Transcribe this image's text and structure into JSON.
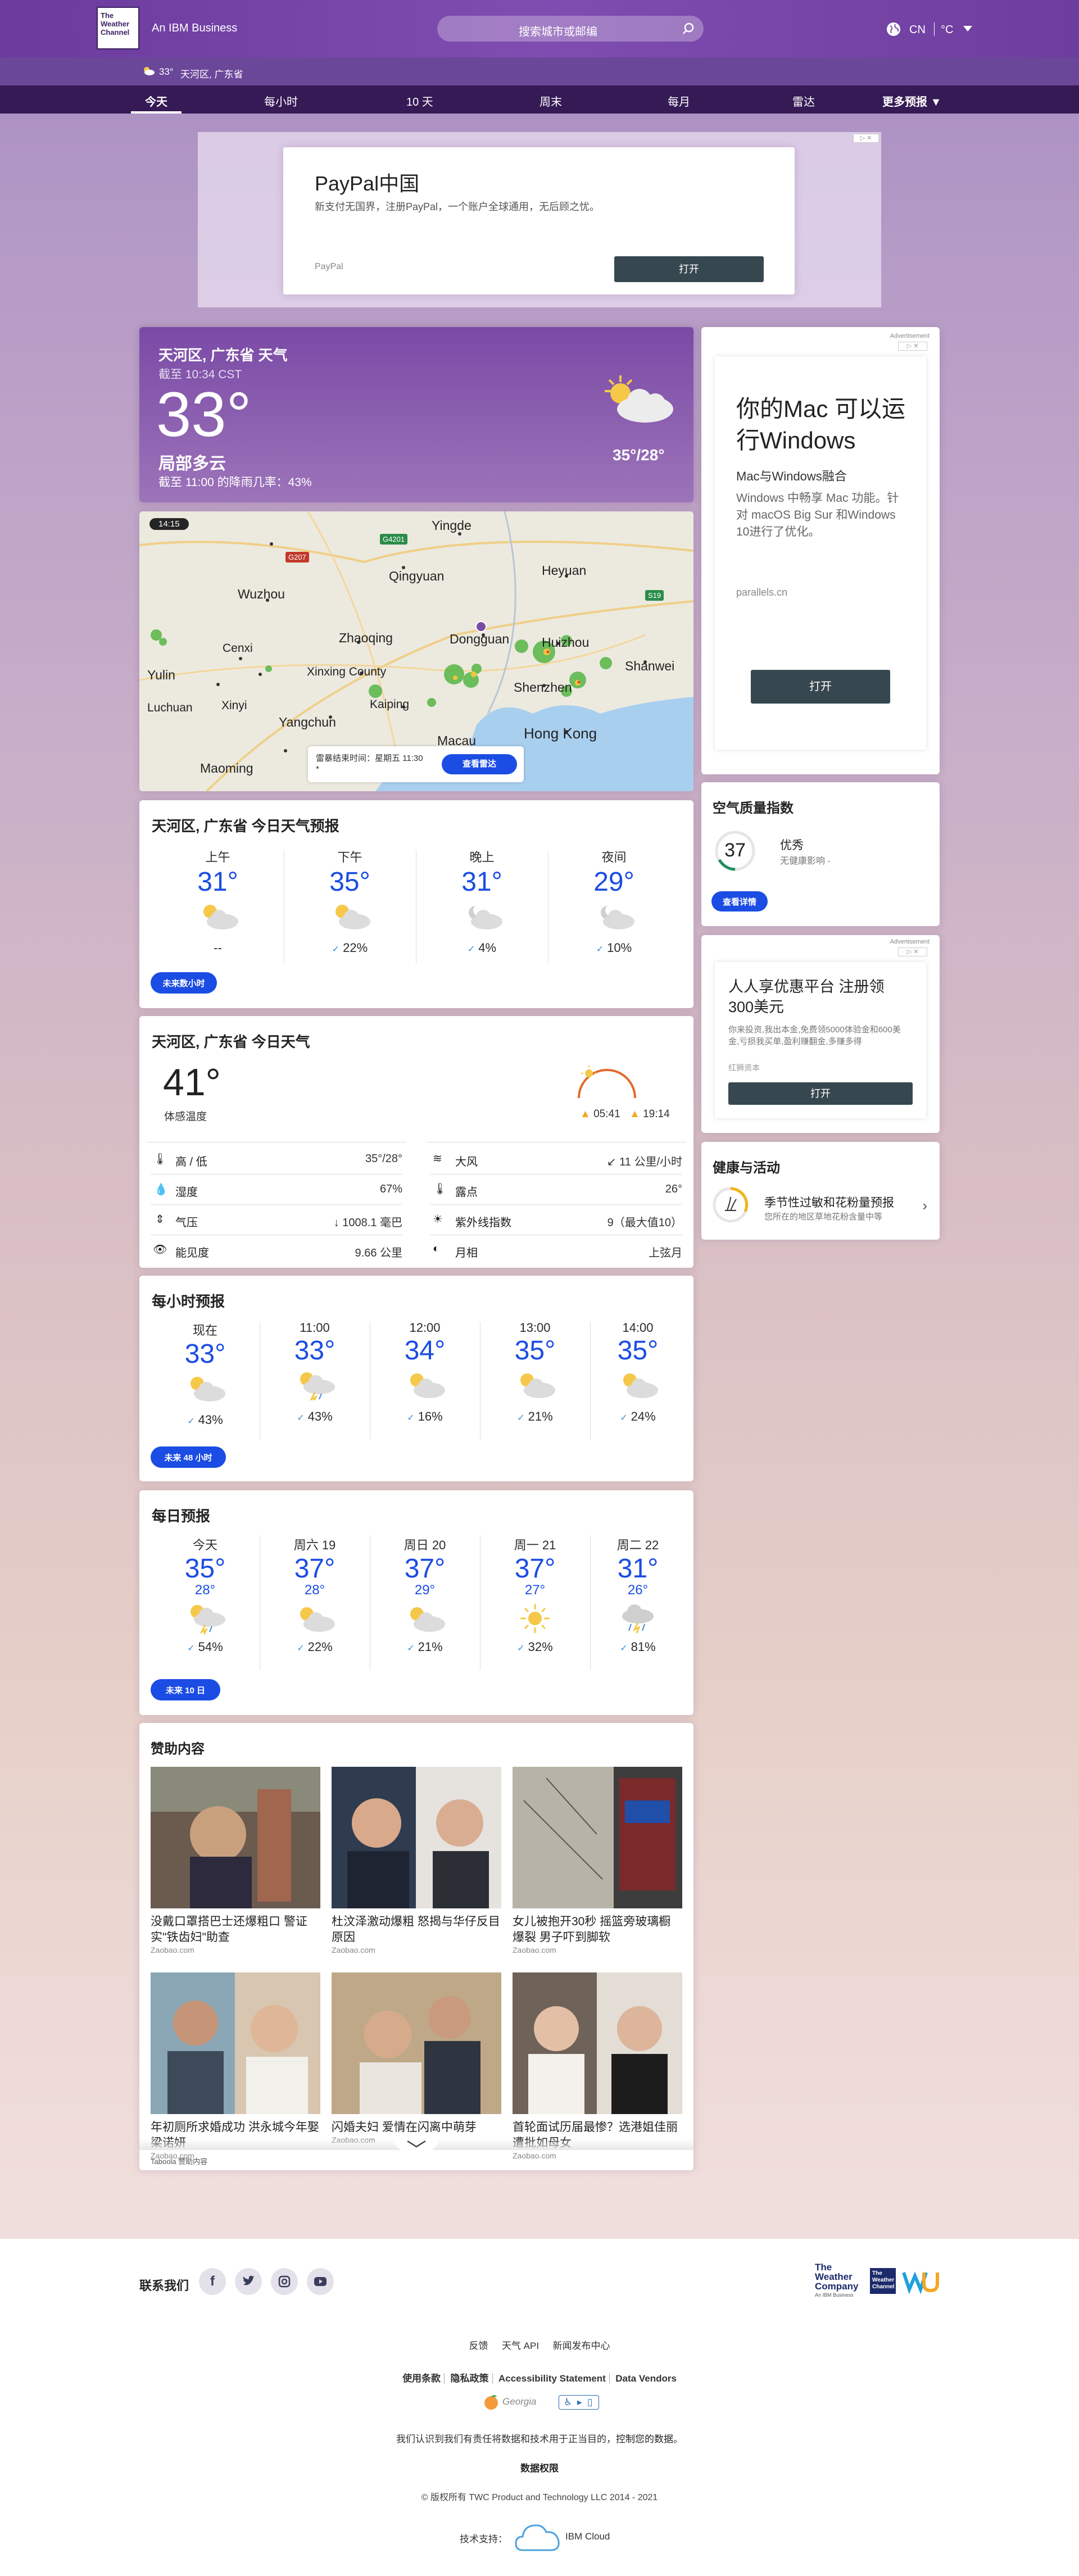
{
  "header": {
    "logo_text": [
      "The",
      "Weather",
      "Channel"
    ],
    "ibm": "An IBM Business",
    "search_placeholder": "搜索城市或邮编",
    "locale": "CN",
    "unit": "°C"
  },
  "subbar": {
    "temp": "33°",
    "location": "天河区, 广东省"
  },
  "nav": {
    "items": [
      "今天",
      "每小时",
      "10 天",
      "周末",
      "每月",
      "雷达",
      "更多预报"
    ]
  },
  "ad_top": {
    "title": "PayPal中国",
    "text": "新支付无国界，注册PayPal，一个账户全球通用，无后顾之忧。",
    "brand": "PayPal",
    "button": "打开"
  },
  "current": {
    "title": "天河区, 广东省 天气",
    "asof": "截至 10:34 CST",
    "temp": "33°",
    "cond": "局部多云",
    "rain": "截至 11:00 的降雨几率：43%",
    "hilo": "35°/28°"
  },
  "radar": {
    "time": "14:15",
    "notice": "雷暴结束时间：星期五 11:30 *",
    "button": "查看雷达",
    "places": [
      "Yingde",
      "Qingyuan",
      "Heyuan",
      "Wuzhou",
      "Zhaoqing",
      "Dongguan",
      "Huizhou",
      "Cenxi",
      "Shanwei",
      "Yulin",
      "Xinxing County",
      "Shenzhen",
      "Luchuan",
      "Xinyi",
      "Kaiping",
      "Yangchun",
      "Hong Kong",
      "Maoming",
      "Macau",
      "S19",
      "G4201",
      "G207"
    ]
  },
  "today_forecast": {
    "title": "天河区, 广东省 今日天气预报",
    "cols": [
      {
        "label": "上午",
        "temp": "31°",
        "rain": "--"
      },
      {
        "label": "下午",
        "temp": "35°",
        "rain": "22%"
      },
      {
        "label": "晚上",
        "temp": "31°",
        "rain": "4%"
      },
      {
        "label": "夜间",
        "temp": "29°",
        "rain": "10%"
      }
    ],
    "button": "未来数小时"
  },
  "details": {
    "title": "天河区, 广东省 今日天气",
    "feels": "41°",
    "feels_label": "体感温度",
    "sunrise": "05:41",
    "sunset": "19:14",
    "left": [
      {
        "label": "高 / 低",
        "value": "35°/28°",
        "icon": "thermometer-icon"
      },
      {
        "label": "湿度",
        "value": "67%",
        "icon": "humidity-icon"
      },
      {
        "label": "气压",
        "value": "1008.1 毫巴",
        "icon": "pressure-icon"
      },
      {
        "label": "能见度",
        "value": "9.66 公里",
        "icon": "visibility-icon"
      }
    ],
    "right": [
      {
        "label": "大风",
        "value": "11 公里/小时",
        "icon": "wind-icon"
      },
      {
        "label": "露点",
        "value": "26°",
        "icon": "dewpoint-icon"
      },
      {
        "label": "紫外线指数",
        "value": "9（最大值10）",
        "icon": "uv-icon"
      },
      {
        "label": "月相",
        "value": "上弦月",
        "icon": "moon-icon"
      }
    ]
  },
  "hourly": {
    "title": "每小时预报",
    "cols": [
      {
        "label": "现在",
        "temp": "33°",
        "rain": "43%"
      },
      {
        "label": "11:00",
        "temp": "33°",
        "rain": "43%"
      },
      {
        "label": "12:00",
        "temp": "34°",
        "rain": "16%"
      },
      {
        "label": "13:00",
        "temp": "35°",
        "rain": "21%"
      },
      {
        "label": "14:00",
        "temp": "35°",
        "rain": "24%"
      }
    ],
    "button": "未来 48 小时"
  },
  "daily": {
    "title": "每日预报",
    "cols": [
      {
        "label": "今天",
        "temp": "35°",
        "low": "28°",
        "rain": "54%"
      },
      {
        "label": "周六 19",
        "temp": "37°",
        "low": "28°",
        "rain": "22%"
      },
      {
        "label": "周日 20",
        "temp": "37°",
        "low": "29°",
        "rain": "21%"
      },
      {
        "label": "周一 21",
        "temp": "37°",
        "low": "27°",
        "rain": "32%"
      },
      {
        "label": "周二 22",
        "temp": "31°",
        "low": "26°",
        "rain": "81%"
      }
    ],
    "button": "未来 10 日"
  },
  "sponsored": {
    "title": "赞助内容",
    "items": [
      {
        "title": "没戴口罩搭巴士还爆粗口 警证实\"铁齿妇\"助查",
        "src": "Zaobao.com"
      },
      {
        "title": "杜汶泽激动爆粗 怒揭与华仔反目原因",
        "src": "Zaobao.com"
      },
      {
        "title": "女儿被抱开30秒 摇篮旁玻璃橱爆裂 男子吓到脚软",
        "src": "Zaobao.com"
      },
      {
        "title": "年初厕所求婚成功 洪永城今年娶梁诺妍",
        "src": "Zaobao.com"
      },
      {
        "title": "闪婚夫妇 爱情在闪离中萌芽",
        "src": "Zaobao.com"
      },
      {
        "title": "首轮面试历届最惨？选港姐佳丽遭批如母女",
        "src": "Zaobao.com"
      }
    ],
    "taboola": "Taboola 赞助内容"
  },
  "ad_right1": {
    "label": "Advertisement",
    "title": "你的Mac 可以运行Windows",
    "sub": "Mac与Windows融合",
    "text": "Windows 中畅享 Mac 功能。针对 macOS Big Sur 和Windows 10进行了优化。",
    "domain": "parallels.cn",
    "button": "打开"
  },
  "aqi": {
    "title": "空气质量指数",
    "value": "37",
    "level": "优秀",
    "desc": "无健康影响 -",
    "button": "查看详情"
  },
  "ad_right2": {
    "label": "Advertisement",
    "title": "人人享优惠平台 注册领300美元",
    "text": "你来投资,我出本金,免费领5000体验金和600美金,亏损我买单,盈利赚翻金,多赚多得",
    "brand": "红狮资本",
    "button": "打开"
  },
  "health": {
    "title": "健康与活动",
    "item_title": "季节性过敏和花粉量预报",
    "item_desc": "您所在的地区草地花粉含量中等"
  },
  "footer": {
    "contact": "联系我们",
    "social": [
      "facebook-icon",
      "twitter-icon",
      "instagram-icon",
      "youtube-icon"
    ],
    "row1": [
      "反馈",
      "天气 API",
      "新闻发布中心"
    ],
    "row2": [
      "使用条款",
      "隐私政策",
      "Accessibility Statement",
      "Data Vendors"
    ],
    "georgia": "Georgia",
    "notice": "我们认识到我们有责任将数据和技术用于正当目的，",
    "notice_link": "控制您的数据",
    "notice_end": "。",
    "data_rights": "数据权限",
    "copyright": "© 版权所有 TWC Product and Technology LLC 2014 - 2021",
    "powered": "技术支持：",
    "ibm_cloud": "IBM Cloud",
    "twc_company": [
      "The",
      "Weather",
      "Company"
    ],
    "twc_sub": "An IBM Business"
  },
  "colors": {
    "brand": "#5a2d8a",
    "accent": "#1b4de4",
    "nav_bg": "#351a55"
  }
}
